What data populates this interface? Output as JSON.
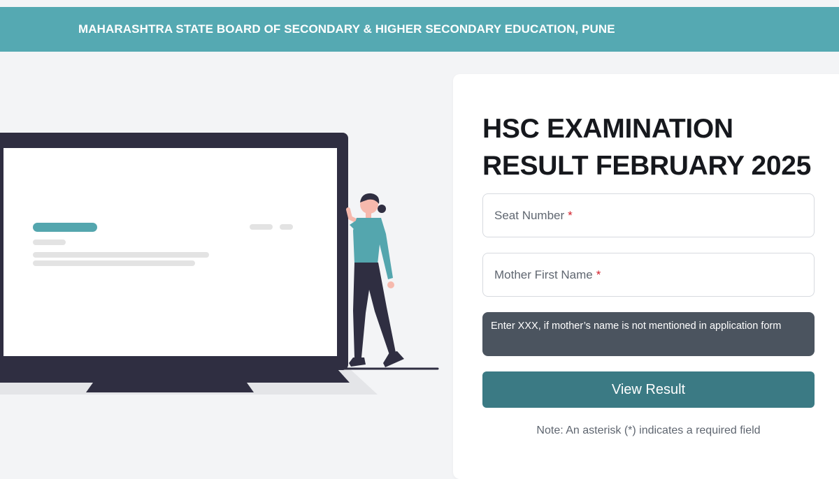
{
  "header": {
    "title": "MAHARASHTRA STATE BOARD OF SECONDARY & HIGHER SECONDARY EDUCATION, PUNE"
  },
  "card": {
    "title_line1": "HSC EXAMINATION",
    "title_line2": "RESULT FEBRUARY 2025",
    "seat_number_placeholder": "Seat Number",
    "mother_name_placeholder": "Mother First Name",
    "required_marker": "*",
    "hint_text": "Enter XXX, if mother’s name is not mentioned in application form",
    "view_button_label": "View Result",
    "note_text": "Note: An asterisk (*) indicates a required field"
  },
  "colors": {
    "header_bg": "#55a9b2",
    "button_bg": "#3b7a84",
    "hint_bg": "#4b545f",
    "required": "#d21f2a",
    "accent_teal": "#54a6ae",
    "laptop_dark": "#2f2e41"
  },
  "illustration": {
    "icon": "laptop-person-illustration"
  }
}
